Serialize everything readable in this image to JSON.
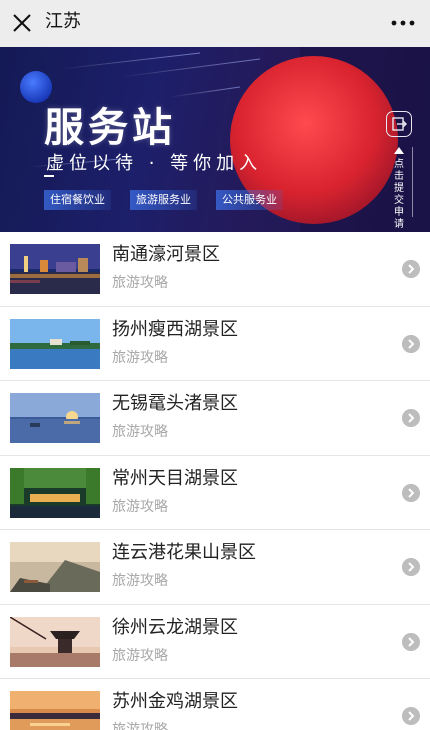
{
  "header": {
    "title": "江苏",
    "close_icon": "close-icon",
    "more_icon": "more-icon"
  },
  "banner": {
    "title": "服务站",
    "slogan": "虚位以待 · 等你加入",
    "tags": [
      "住宿餐饮业",
      "旅游服务业",
      "公共服务业"
    ],
    "apply_label": "点击提交申请",
    "apply_icon": "exit-icon",
    "page_count": 2,
    "active_page": 1
  },
  "list": {
    "items": [
      {
        "title": "南通濠河景区",
        "subtitle": "旅游攻略"
      },
      {
        "title": "扬州瘦西湖景区",
        "subtitle": "旅游攻略"
      },
      {
        "title": "无锡鼋头渚景区",
        "subtitle": "旅游攻略"
      },
      {
        "title": "常州天目湖景区",
        "subtitle": "旅游攻略"
      },
      {
        "title": "连云港花果山景区",
        "subtitle": "旅游攻略"
      },
      {
        "title": "徐州云龙湖景区",
        "subtitle": "旅游攻略"
      },
      {
        "title": "苏州金鸡湖景区",
        "subtitle": "旅游攻略"
      }
    ]
  },
  "colors": {
    "background": "#ededed",
    "banner_navy": "#1d1f6a",
    "banner_red": "#e0303a",
    "arrow_gray": "#bdbdbd",
    "subtitle_gray": "#a8a8a8"
  }
}
